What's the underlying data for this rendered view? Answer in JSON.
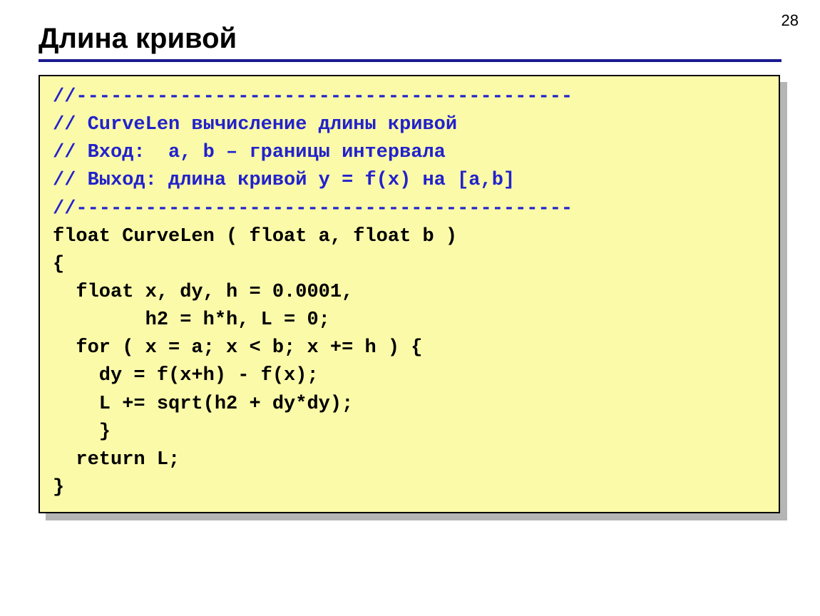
{
  "page_number": "28",
  "title": "Длина кривой",
  "code": {
    "l1": "//-------------------------------------------",
    "l2": "// CurveLen вычисление длины кривой",
    "l3": "// Вход:  a, b – границы интервала",
    "l4": "// Выход: длина кривой y = f(x) на [a,b]",
    "l5": "//-------------------------------------------",
    "l6": "float CurveLen ( float a, float b )",
    "l7": "{",
    "l8": "  float x, dy, h = 0.0001,",
    "l9": "        h2 = h*h, L = 0;",
    "l10": "  for ( x = a; x < b; x += h ) {",
    "l11": "    dy = f(x+h) - f(x);",
    "l12": "    L += sqrt(h2 + dy*dy);",
    "l13": "    }",
    "l14": "  return L;",
    "l15": "}"
  }
}
